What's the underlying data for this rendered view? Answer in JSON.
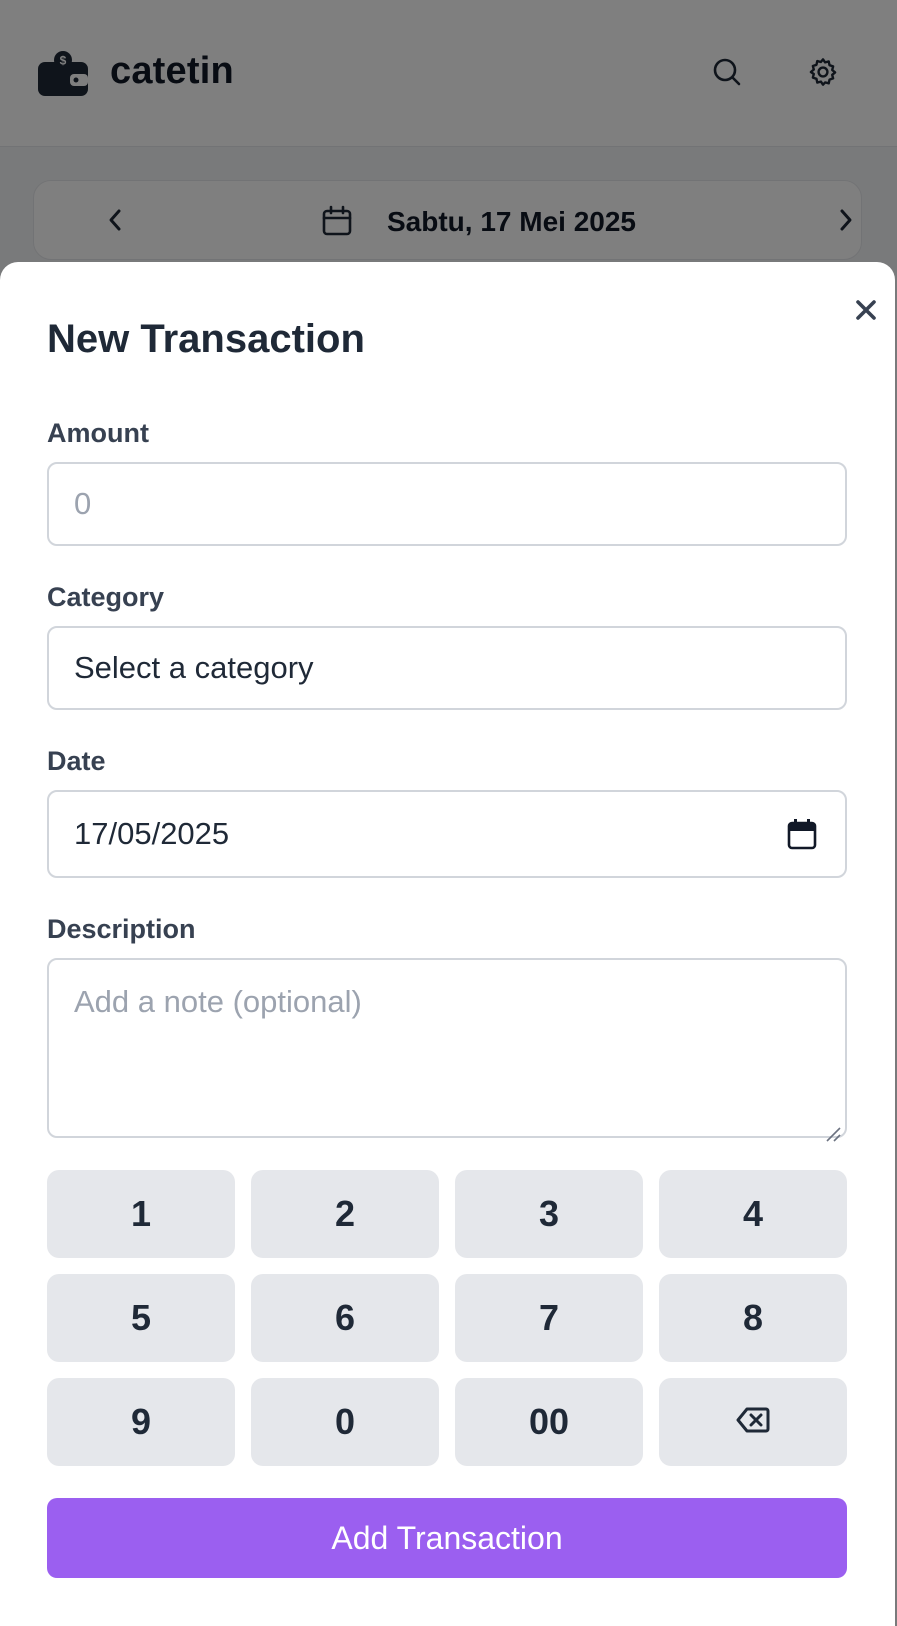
{
  "app": {
    "title": "catetin",
    "date_nav": {
      "label": "Sabtu, 17 Mei 2025"
    }
  },
  "modal": {
    "title": "New Transaction",
    "amount": {
      "label": "Amount",
      "placeholder": "0"
    },
    "category": {
      "label": "Category",
      "value": "Select a category"
    },
    "date": {
      "label": "Date",
      "value": "17/05/2025"
    },
    "description": {
      "label": "Description",
      "placeholder": "Add a note (optional)"
    },
    "keypad": [
      "1",
      "2",
      "3",
      "4",
      "5",
      "6",
      "7",
      "8",
      "9",
      "0",
      "00"
    ],
    "submit_label": "Add Transaction"
  },
  "colors": {
    "accent": "#9b5ff0",
    "key_bg": "#e5e7eb",
    "overlay": "rgba(0,0,0,0.5)"
  },
  "icons": [
    "wallet-icon",
    "search-icon",
    "gear-icon",
    "chevron-left-icon",
    "calendar-icon",
    "chevron-right-icon",
    "close-icon",
    "backspace-icon"
  ]
}
